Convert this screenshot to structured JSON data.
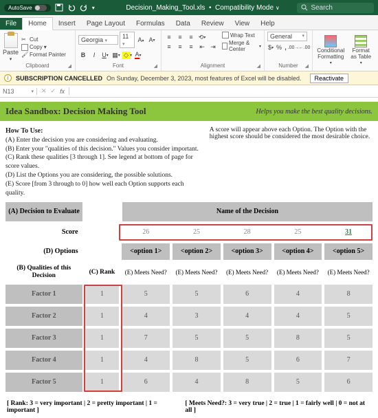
{
  "titlebar": {
    "autosave_label": "AutoSave",
    "autosave_state": "Off",
    "filename": "Decision_Making_Tool.xls",
    "compat": "Compatibility Mode",
    "search_placeholder": "Search"
  },
  "tabs": [
    "File",
    "Home",
    "Insert",
    "Page Layout",
    "Formulas",
    "Data",
    "Review",
    "View",
    "Help"
  ],
  "ribbon": {
    "clipboard": {
      "paste": "Paste",
      "cut": "Cut",
      "copy": "Copy",
      "fp": "Format Painter",
      "label": "Clipboard"
    },
    "font": {
      "name": "Georgia",
      "size": "11",
      "label": "Font"
    },
    "alignment": {
      "wrap": "Wrap Text",
      "merge": "Merge & Center",
      "label": "Alignment"
    },
    "number": {
      "format": "General",
      "label": "Number"
    },
    "styles": {
      "cf": "Conditional Formatting",
      "fat": "Format as Table"
    }
  },
  "warning": {
    "title": "SUBSCRIPTION CANCELLED",
    "msg": "On Sunday, December 3, 2023, most features of Excel will be disabled.",
    "btn": "Reactivate"
  },
  "formula": {
    "cell": "N13"
  },
  "banner": {
    "title": "Idea Sandbox: Decision Making Tool",
    "sub": "Helps you make the best quality decisions."
  },
  "howto": {
    "heading": "How To Use:",
    "a": "(A) Enter the decision you are considering and evaluating.",
    "b": "(B) Enter your \"qualities of this decision.\" Values you consider important.",
    "c": "(C) Rank these qualities [3 through 1]. See legend at bottom of page for score values.",
    "d": "(D) List the Options you are considering, the possible solutions.",
    "e": "(E) Score [from 3 through to 0] how well each Option supports each quality.",
    "right": "A score will appear above each Option. The Option with the highest score should be considered the most desirable choice."
  },
  "grid": {
    "decision_label": "(A) Decision to Evaluate",
    "decision_name": "Name of the Decision",
    "score_label": "Score",
    "scores": [
      "26",
      "25",
      "28",
      "25",
      "31"
    ],
    "options_label": "(D) Options",
    "options": [
      "<option 1>",
      "<option 2>",
      "<option 3>",
      "<option 4>",
      "<option 5>"
    ],
    "qualities_label": "(B) Qualities of this Decision",
    "rank_label": "(C) Rank",
    "meets_label": "(E) Meets Need?",
    "rows": [
      {
        "name": "Factor 1",
        "rank": "1",
        "vals": [
          "5",
          "5",
          "6",
          "4",
          "8"
        ]
      },
      {
        "name": "Factor 2",
        "rank": "1",
        "vals": [
          "4",
          "3",
          "4",
          "4",
          "5"
        ]
      },
      {
        "name": "Factor 3",
        "rank": "1",
        "vals": [
          "7",
          "5",
          "5",
          "8",
          "5"
        ]
      },
      {
        "name": "Factor 4",
        "rank": "1",
        "vals": [
          "4",
          "8",
          "5",
          "6",
          "7"
        ]
      },
      {
        "name": "Factor 5",
        "rank": "1",
        "vals": [
          "6",
          "4",
          "8",
          "5",
          "6"
        ]
      }
    ],
    "max_score_index": 4
  },
  "legend": {
    "rank": "[ Rank: 3 = very important | 2 = pretty important | 1 = important ]",
    "meets": "[ Meets Need?: 3 = very true | 2 = true | 1 = fairly well | 0 = not at all ]"
  }
}
